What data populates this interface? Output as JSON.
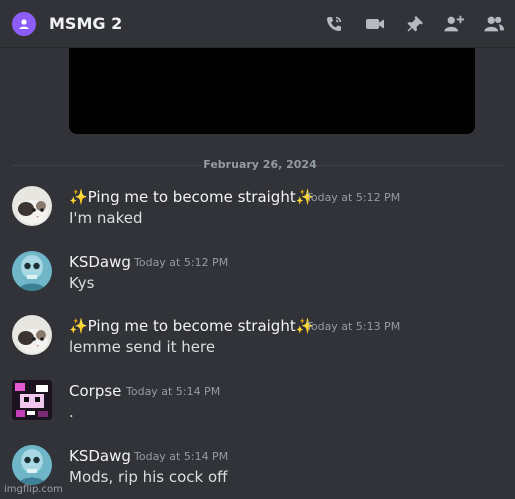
{
  "header": {
    "title": "MSMG 2",
    "icons": [
      "group-icon",
      "call-icon",
      "video-icon",
      "pin-icon",
      "add-friend-icon",
      "member-list-icon"
    ]
  },
  "divider": {
    "date": "February 26, 2024"
  },
  "messages": [
    {
      "username": "✨Ping me to become straight✨",
      "timestamp": "Today at 5:12 PM",
      "text": "I'm naked"
    },
    {
      "username": "KSDawg",
      "timestamp": "Today at 5:12 PM",
      "text": "Kys"
    },
    {
      "username": "✨Ping me to become straight✨",
      "timestamp": "Today at 5:13 PM",
      "text": "lemme send it here"
    },
    {
      "username": "Corpse",
      "timestamp": "Today at 5:14 PM",
      "text": "."
    },
    {
      "username": "KSDawg",
      "timestamp": "Today at 5:14 PM",
      "text": "Mods, rip his cock off"
    }
  ],
  "watermark": "imgflip.com",
  "colors": {
    "background": "#313338",
    "accent_group": "#8b5cf6",
    "username": "#f2f3f5",
    "muted": "#949ba4"
  }
}
